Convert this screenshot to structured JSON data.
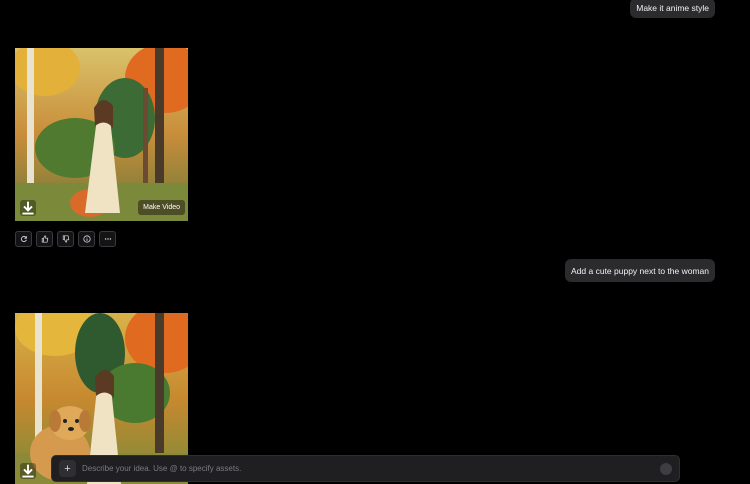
{
  "messages": {
    "user_prompt_1": "Make it anime style",
    "user_prompt_2": "Add a cute puppy next to the woman"
  },
  "result_1": {
    "make_video_label": "Make Video",
    "actions": [
      {
        "icon": "regenerate-icon"
      },
      {
        "icon": "thumbs-up-icon"
      },
      {
        "icon": "thumbs-down-icon"
      },
      {
        "icon": "info-icon"
      },
      {
        "icon": "more-icon"
      }
    ]
  },
  "composer": {
    "placeholder": "Describe your idea. Use @ to specify assets."
  },
  "colors": {
    "background": "#000000",
    "bubble": "#2b2b2e",
    "composer": "#1f1f22"
  }
}
